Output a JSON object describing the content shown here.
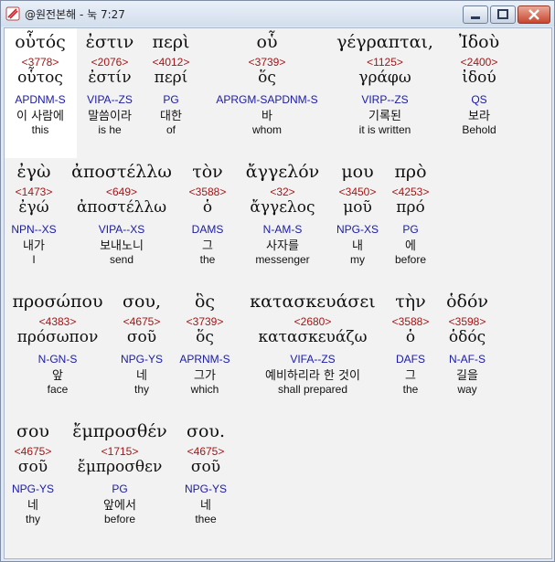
{
  "window": {
    "title": "@원전본해 - 눅 7:27"
  },
  "rows": [
    {
      "words": [
        {
          "greek": "οὗτός",
          "strong": "<3778>",
          "lemma": "οὗτος",
          "parse": "APDNM-S",
          "korean": "이 사람에",
          "english": "this"
        },
        {
          "greek": "ἐστιν",
          "strong": "<2076>",
          "lemma": "ἐστίν",
          "parse": "VIPA--ZS",
          "korean": "말씀이라",
          "english": "is he"
        },
        {
          "greek": "περὶ",
          "strong": "<4012>",
          "lemma": "περί",
          "parse": "PG",
          "korean": "대한",
          "english": "of"
        },
        {
          "greek": "οὗ",
          "strong": "<3739>",
          "lemma": "ὅς",
          "parse": "APRGM-SAPDNM-S",
          "korean": "바",
          "english": "whom"
        },
        {
          "greek": "γέγραπται,",
          "strong": "<1125>",
          "lemma": "γράφω",
          "parse": "VIRP--ZS",
          "korean": "기록된",
          "english": "it is written"
        },
        {
          "greek": "Ἰδοὺ",
          "strong": "<2400>",
          "lemma": "ἰδού",
          "parse": "QS",
          "korean": "보라",
          "english": "Behold"
        }
      ]
    },
    {
      "words": [
        {
          "greek": "ἐγὼ",
          "strong": "<1473>",
          "lemma": "ἐγώ",
          "parse": "NPN--XS",
          "korean": "내가",
          "english": "I"
        },
        {
          "greek": "ἀποστέλλω",
          "strong": "<649>",
          "lemma": "ἀποστέλλω",
          "parse": "VIPA--XS",
          "korean": "보내노니",
          "english": "send"
        },
        {
          "greek": "τὸν",
          "strong": "<3588>",
          "lemma": "ὁ",
          "parse": "DAMS",
          "korean": "그",
          "english": "the"
        },
        {
          "greek": "ἄγγελόν",
          "strong": "<32>",
          "lemma": "ἄγγελος",
          "parse": "N-AM-S",
          "korean": "사자를",
          "english": "messenger"
        },
        {
          "greek": "μου",
          "strong": "<3450>",
          "lemma": "μοῦ",
          "parse": "NPG-XS",
          "korean": "내",
          "english": "my"
        },
        {
          "greek": "πρὸ",
          "strong": "<4253>",
          "lemma": "πρό",
          "parse": "PG",
          "korean": "에",
          "english": "before"
        }
      ]
    },
    {
      "words": [
        {
          "greek": "προσώπου",
          "strong": "<4383>",
          "lemma": "πρόσωπον",
          "parse": "N-GN-S",
          "korean": "앞",
          "english": "face"
        },
        {
          "greek": "σου,",
          "strong": "<4675>",
          "lemma": "σοῦ",
          "parse": "NPG-YS",
          "korean": "네",
          "english": "thy"
        },
        {
          "greek": "ὃς",
          "strong": "<3739>",
          "lemma": "ὅς",
          "parse": "APRNM-S",
          "korean": "그가",
          "english": "which"
        },
        {
          "greek": "κατασκευάσει",
          "strong": "<2680>",
          "lemma": "κατασκευάζω",
          "parse": "VIFA--ZS",
          "korean": "예비하리라 한 것이",
          "english": "shall prepared"
        },
        {
          "greek": "τὴν",
          "strong": "<3588>",
          "lemma": "ὁ",
          "parse": "DAFS",
          "korean": "그",
          "english": "the"
        },
        {
          "greek": "ὁδόν",
          "strong": "<3598>",
          "lemma": "ὁδός",
          "parse": "N-AF-S",
          "korean": "길을",
          "english": "way"
        }
      ]
    },
    {
      "words": [
        {
          "greek": "σου",
          "strong": "<4675>",
          "lemma": "σοῦ",
          "parse": "NPG-YS",
          "korean": "네",
          "english": "thy"
        },
        {
          "greek": "ἔμπροσθέν",
          "strong": "<1715>",
          "lemma": "ἔμπροσθεν",
          "parse": "PG",
          "korean": "앞에서",
          "english": "before"
        },
        {
          "greek": "σου.",
          "strong": "<4675>",
          "lemma": "σοῦ",
          "parse": "NPG-YS",
          "korean": "네",
          "english": "thee"
        }
      ]
    }
  ]
}
